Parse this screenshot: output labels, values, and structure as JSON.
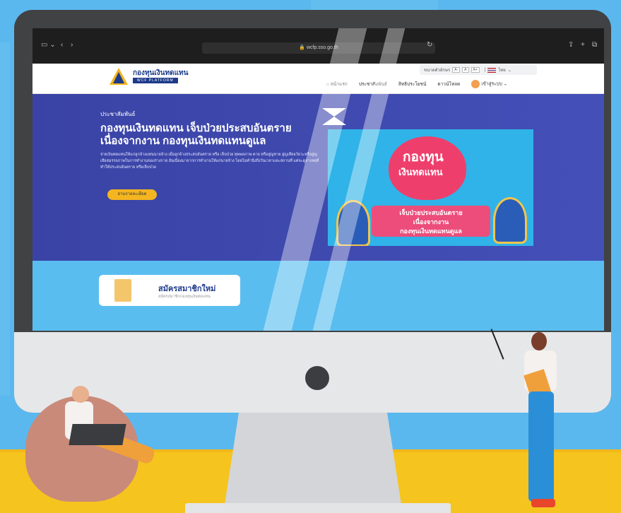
{
  "browser": {
    "url": "wcfp.sso.go.th"
  },
  "site": {
    "logo_text": "กองทุนเงินทดแทน",
    "logo_sub": "WCF PLATFORM",
    "text_size_label": "ขนาดตัวอักษร",
    "text_size_buttons": [
      "A-",
      "A",
      "A+"
    ],
    "language": "ไทย",
    "nav": [
      "หน้าแรก",
      "ประชาสัมพันธ์",
      "สิทธิประโยชน์",
      "ดาวน์โหลด"
    ],
    "login": "เข้าสู่ระบบ"
  },
  "hero": {
    "section_label": "ประชาสัมพันธ์",
    "title": "กองทุนเงินทดแทน เจ็บป่วยประสบอันตรายเนื่องจากงาน กองทุนเงินทดแทนดูแล",
    "description": "จ่ายเงินทดแทนให้แก่ลูกจ้างแทนนายจ้าง เมื่อลูกจ้างประสบอันตราย หรือ เจ็บป่วย ทุพพลภาพ ตาย หรือสูญหาย สูญเสียอวัยวะหรือสูญเสียสมรรถภาพในการทำงานของร่างกาย อันเนื่องมาจากการทำงานให้แก่นายจ้าง โดยไม่คำนึงถึงวันเวลาและสถานที่ แต่จะดูสาเหตุที่ทำให้ประสบอันตราย หรือเจ็บป่วย",
    "button": "อ่านรายละเอียด",
    "poster_line1": "กองทุน",
    "poster_line2": "เงินทดแทน",
    "poster_ribbon1": "เจ็บป่วยประสบอันตราย",
    "poster_ribbon2": "เนื่องจากงาน",
    "poster_ribbon3": "กองทุนเงินทดแทนดูแล"
  },
  "register": {
    "title": "สมัครสมาชิกใหม่",
    "subtitle": "สมัครสมาชิกกองทุนเงินทดแทน"
  },
  "colors": {
    "hero": "#3a43a5",
    "accent": "#f5b520",
    "sky": "#5ab8ee",
    "floor": "#f6c41e"
  }
}
